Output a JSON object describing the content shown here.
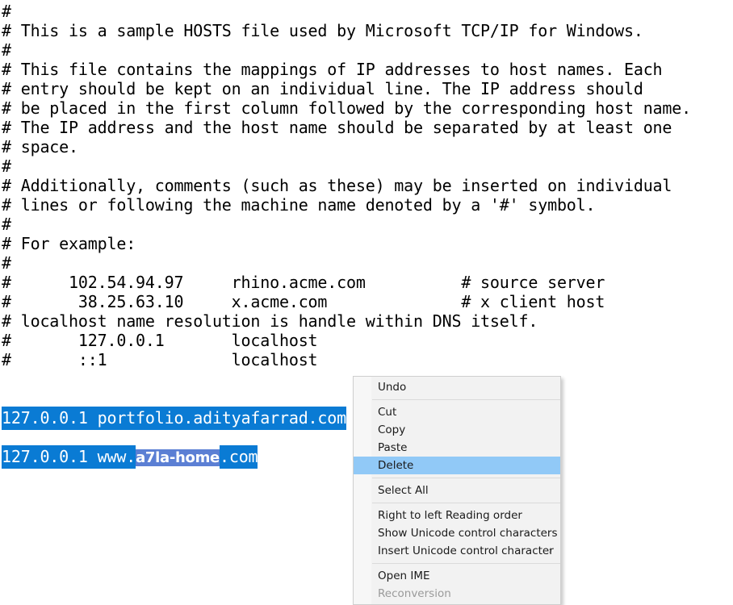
{
  "editor": {
    "lines": [
      "#",
      "# This is a sample HOSTS file used by Microsoft TCP/IP for Windows.",
      "#",
      "# This file contains the mappings of IP addresses to host names. Each",
      "# entry should be kept on an individual line. The IP address should",
      "# be placed in the first column followed by the corresponding host name.",
      "# The IP address and the host name should be separated by at least one",
      "# space.",
      "#",
      "# Additionally, comments (such as these) may be inserted on individual",
      "# lines or following the machine name denoted by a '#' symbol.",
      "#",
      "# For example:",
      "#",
      "#      102.54.94.97     rhino.acme.com          # source server",
      "#       38.25.63.10     x.acme.com              # x client host",
      "# localhost name resolution is handle within DNS itself.",
      "#       127.0.0.1       localhost",
      "#       ::1             localhost",
      "",
      ""
    ],
    "selected_entries": [
      {
        "prefix": "127.0.0.1 portfolio.adityafarrad.com",
        "emphasis": "",
        "suffix": ""
      },
      {
        "prefix": "127.0.0.1 www.",
        "emphasis": "a7la-home",
        "suffix": ".com"
      }
    ]
  },
  "context_menu": {
    "groups": [
      {
        "items": [
          {
            "label": "Undo",
            "state": "normal",
            "submenu": false
          }
        ]
      },
      {
        "items": [
          {
            "label": "Cut",
            "state": "normal",
            "submenu": false
          },
          {
            "label": "Copy",
            "state": "normal",
            "submenu": false
          },
          {
            "label": "Paste",
            "state": "normal",
            "submenu": false
          },
          {
            "label": "Delete",
            "state": "selected",
            "submenu": false
          }
        ]
      },
      {
        "items": [
          {
            "label": "Select All",
            "state": "normal",
            "submenu": false
          }
        ]
      },
      {
        "items": [
          {
            "label": "Right to left Reading order",
            "state": "normal",
            "submenu": false
          },
          {
            "label": "Show Unicode control characters",
            "state": "normal",
            "submenu": false
          },
          {
            "label": "Insert Unicode control character",
            "state": "normal",
            "submenu": true
          }
        ]
      },
      {
        "items": [
          {
            "label": "Open IME",
            "state": "normal",
            "submenu": false
          },
          {
            "label": "Reconversion",
            "state": "disabled",
            "submenu": false
          }
        ]
      }
    ],
    "submenu_arrow_glyph": "›"
  },
  "colors": {
    "selection_blue": "#0a7bd4",
    "selection_alt": "#5b7fd4",
    "menu_highlight": "#91c9f7",
    "menu_background": "#f2f2f2",
    "menu_separator": "#dadada",
    "text": "#000000",
    "disabled_text": "#9a9a9a"
  }
}
